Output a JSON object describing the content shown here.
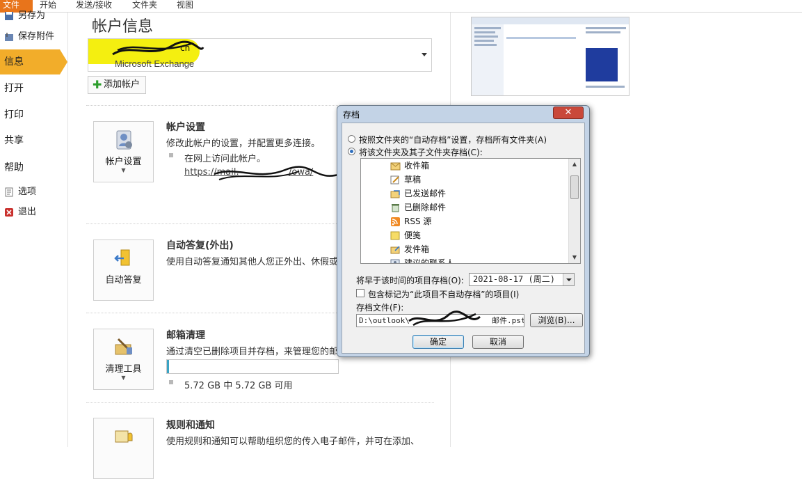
{
  "ribbon": {
    "tabs": [
      "文件",
      "开始",
      "发送/接收",
      "文件夹",
      "视图"
    ]
  },
  "nav": {
    "items": [
      {
        "label": "另存为"
      },
      {
        "label": "保存附件"
      },
      {
        "label": "信息"
      },
      {
        "label": "打开"
      },
      {
        "label": "打印"
      },
      {
        "label": "共享"
      },
      {
        "label": "帮助"
      },
      {
        "label": "选项"
      },
      {
        "label": "退出"
      }
    ]
  },
  "main": {
    "title": "帐户信息",
    "account": {
      "email": "cn",
      "type": "Microsoft Exchange"
    },
    "add_account": "添加帐户",
    "sections": [
      {
        "button": "帐户设置",
        "title": "帐户设置",
        "desc": "修改此帐户的设置，并配置更多连接。",
        "sub": "在网上访问此帐户。",
        "link": "https://mail.",
        "link_tail": "/owa/"
      },
      {
        "button": "自动答复",
        "title": "自动答复(外出)",
        "desc": "使用自动答复通知其他人您正外出、休假或"
      },
      {
        "button": "清理工具",
        "title": "邮箱清理",
        "desc": "通过清空已删除项目并存档，来管理您的邮",
        "quota_text": "5.72 GB 中 5.72 GB 可用",
        "quota_used_fraction": 0.01
      },
      {
        "button": "",
        "title": "规则和通知",
        "desc": "使用规则和通知可以帮助组织您的传入电子邮件，并可在添加、"
      }
    ]
  },
  "dialog": {
    "title": "存档",
    "close": "✕",
    "option1": "按照文件夹的“自动存档”设置，存档所有文件夹(A)",
    "option2": "将该文件夹及其子文件夹存档(C):",
    "folders": [
      {
        "label": "收件箱",
        "icon": "inbox-icon"
      },
      {
        "label": "草稿",
        "icon": "drafts-icon"
      },
      {
        "label": "已发送邮件",
        "icon": "sent-icon"
      },
      {
        "label": "已删除邮件",
        "icon": "deleted-icon"
      },
      {
        "label": "RSS 源",
        "icon": "rss-icon"
      },
      {
        "label": "便笺",
        "icon": "notes-icon"
      },
      {
        "label": "发件箱",
        "icon": "outbox-icon"
      },
      {
        "label": "建议的联系人",
        "icon": "contacts-icon"
      }
    ],
    "date_label": "将早于该时间的项目存档(O):",
    "date_value": "2021-08-17 (周二)",
    "include_label": "包含标记为“此项目不自动存档”的项目(I)",
    "file_label": "存档文件(F):",
    "file_path": "D:\\outlook\\",
    "file_path_tail": "邮件.pst",
    "browse": "浏览(B)...",
    "ok": "确定",
    "cancel": "取消"
  },
  "colors": {
    "file_tab": "#e8741b",
    "nav_active": "#f2ad2a",
    "redaction_highlight": "#f4ef10",
    "quota_fill": "#3aa3c4",
    "dialog_frame": "#c3d3e6",
    "close_button": "#c9483a"
  }
}
